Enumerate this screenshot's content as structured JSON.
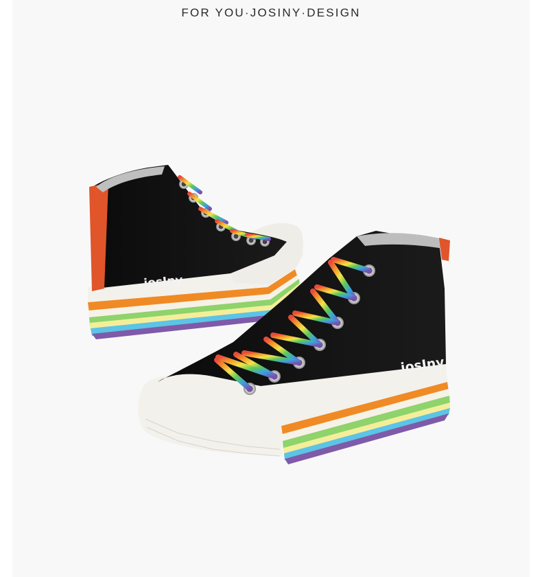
{
  "header": {
    "tagline": "FOR YOU·JOSINY·DESIGN"
  },
  "product": {
    "back_shoe_brand": "josIny",
    "front_shoe_brand": "josIny"
  },
  "colors": {
    "background": "#f8f8f8",
    "canvas": "#111111",
    "toe_cap": "#f1efea",
    "orange_panel": "#e0552a",
    "sole_stripes": [
      "#f08a24",
      "#f6f2e8",
      "#8ed36b",
      "#f4ee9a",
      "#5cc4e6",
      "#7f5aa8"
    ]
  },
  "icons": [
    "rainbow-lace-icon",
    "eyelet-icon"
  ]
}
